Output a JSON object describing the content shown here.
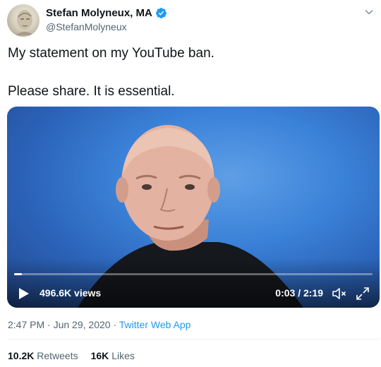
{
  "author": {
    "display_name": "Stefan Molyneux, MA",
    "handle": "@StefanMolyneux",
    "verified": true
  },
  "tweet": {
    "line1": "My statement on my YouTube ban.",
    "line2": "Please share. It is essential."
  },
  "video": {
    "views": "496.6K views",
    "time": "0:03 / 2:19",
    "progress_fraction": 0.022
  },
  "meta": {
    "time": "2:47 PM",
    "separator": "·",
    "date": "Jun 29, 2020",
    "app": "Twitter Web App"
  },
  "stats": {
    "retweets_count": "10.2K",
    "retweets_label": "Retweets",
    "likes_count": "16K",
    "likes_label": "Likes"
  },
  "colors": {
    "accent": "#1d9bf0",
    "text": "#0f1419",
    "secondary": "#536471"
  },
  "icons": [
    "verified-badge-icon",
    "chevron-down-icon",
    "play-icon",
    "volume-muted-icon",
    "fullscreen-icon"
  ]
}
